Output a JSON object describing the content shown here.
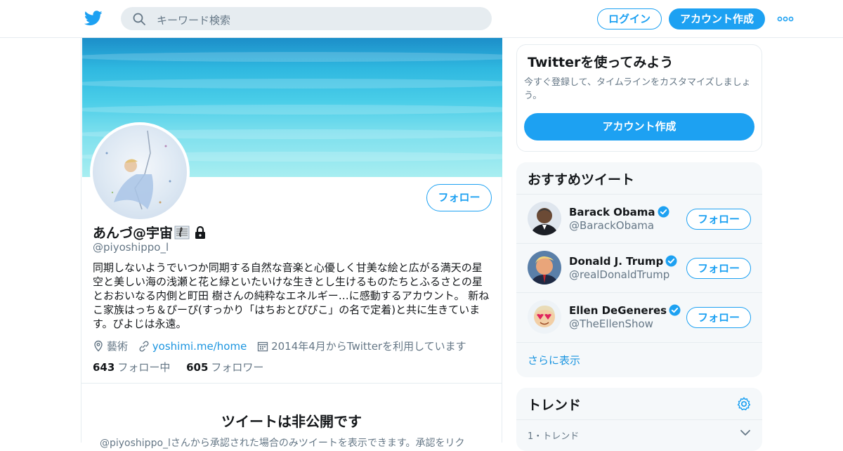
{
  "header": {
    "logo_icon": "twitter-bird-icon",
    "search_placeholder": "キーワード検索",
    "login_label": "ログイン",
    "signup_label": "アカウント作成",
    "more_icon": "more-dots-icon",
    "brand_color": "#1da1f2"
  },
  "profile": {
    "display_name": "あんづ@宇宙",
    "handle": "@piyoshippo_l",
    "follow_label": "フォロー",
    "bio": "同期しないようでいつか同期する自然な音楽と心優しく甘美な絵と広がる満天の星空と美しい海の浅瀬と花と緑といたいけな生きとし生けるものたちとふるさとの星とおおいなる内側と町田 樹さんの純粋なエネルギー…に感動するアカウント。 新ねこ家族はっち＆ぴーぴ(すっかり「はちおとぴぴこ」の名で定着)と共に生きています。ぴよじは永遠。",
    "location": "藝術",
    "website": "yoshimi.me/home",
    "joined": "2014年4月からTwitterを利用しています",
    "following_count": "643",
    "following_label": "フォロー中",
    "followers_count": "605",
    "followers_label": "フォロワー",
    "private_title": "ツイートは非公開です",
    "private_desc": "@piyoshippo_lさんから承認された場合のみツイートを表示できます。承認をリク"
  },
  "signup_card": {
    "title": "Twitterを使ってみよう",
    "description": "今すぐ登録して、タイムラインをカスタマイズしましょう。",
    "cta_label": "アカウント作成"
  },
  "who_to_follow": {
    "title": "おすすめツイート",
    "users": [
      {
        "name": "Barack Obama",
        "handle": "@BarackObama",
        "follow_label": "フォロー"
      },
      {
        "name": "Donald J. Trump",
        "handle": "@realDonaldTrump",
        "follow_label": "フォロー"
      },
      {
        "name": "Ellen DeGeneres",
        "handle": "@TheEllenShow",
        "follow_label": "フォロー"
      }
    ],
    "show_more": "さらに表示"
  },
  "trends": {
    "title": "トレンド",
    "first_meta": "1・トレンド"
  }
}
